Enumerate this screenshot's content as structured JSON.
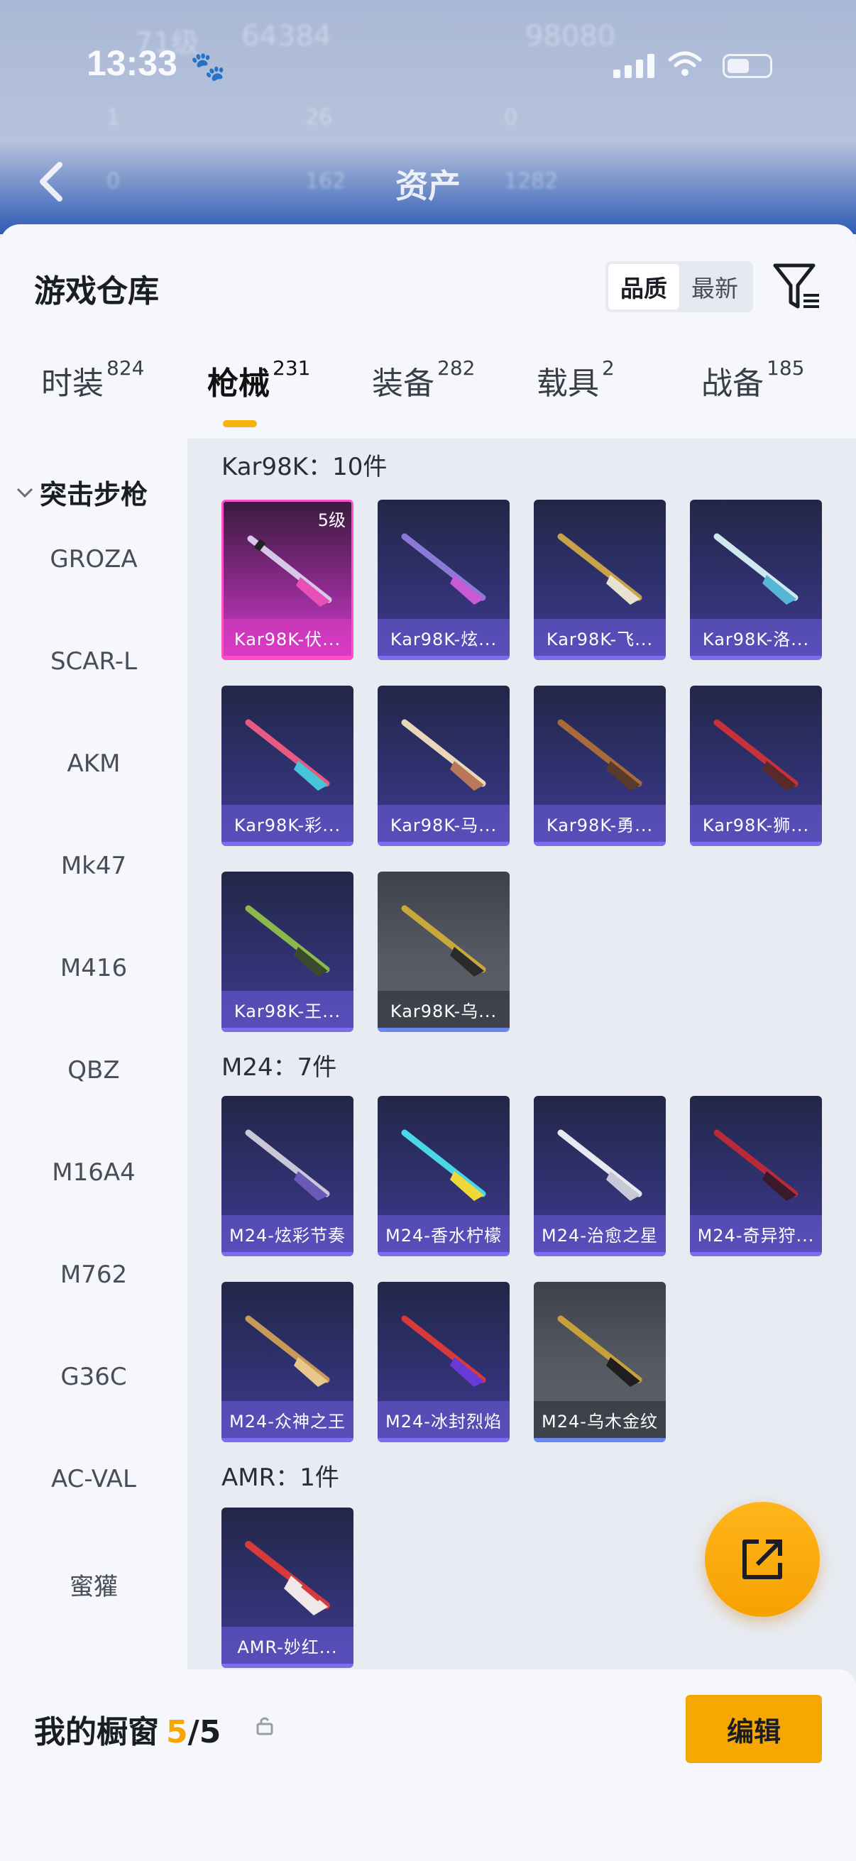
{
  "status_bar": {
    "time": "13:33"
  },
  "background": {
    "level_text": "71级",
    "stat_a": "64384",
    "stat_b": "98080",
    "row1": [
      "1",
      "26",
      "0"
    ],
    "row2": [
      "0",
      "162",
      "1282"
    ],
    "nav_title": "资产"
  },
  "sheet": {
    "title": "游戏仓库",
    "sort_options": [
      {
        "label": "品质",
        "active": true
      },
      {
        "label": "最新",
        "active": false
      }
    ]
  },
  "tabs": [
    {
      "label": "时装",
      "count": "824"
    },
    {
      "label": "枪械",
      "count": "231"
    },
    {
      "label": "装备",
      "count": "282"
    },
    {
      "label": "载具",
      "count": "2"
    },
    {
      "label": "战备",
      "count": "185"
    }
  ],
  "active_tab": "枪械",
  "sidebar": {
    "category": "突击步枪",
    "items": [
      "GROZA",
      "SCAR-L",
      "AKM",
      "Mk47",
      "M416",
      "QBZ",
      "M16A4",
      "M762",
      "G36C",
      "AC-VAL",
      "蜜獾"
    ]
  },
  "groups": [
    {
      "title": "Kar98K：10件",
      "items": [
        {
          "label": "Kar98K-伏...",
          "rarity": "pink",
          "badge": "5级"
        },
        {
          "label": "Kar98K-炫...",
          "rarity": "purple"
        },
        {
          "label": "Kar98K-飞...",
          "rarity": "purple"
        },
        {
          "label": "Kar98K-洛...",
          "rarity": "purple"
        },
        {
          "label": "Kar98K-彩...",
          "rarity": "purple"
        },
        {
          "label": "Kar98K-马...",
          "rarity": "purple"
        },
        {
          "label": "Kar98K-勇...",
          "rarity": "purple"
        },
        {
          "label": "Kar98K-狮...",
          "rarity": "purple"
        },
        {
          "label": "Kar98K-王...",
          "rarity": "purple"
        },
        {
          "label": "Kar98K-乌...",
          "rarity": "grey"
        }
      ]
    },
    {
      "title": "M24：7件",
      "items": [
        {
          "label": "M24-炫彩节奏",
          "rarity": "purple"
        },
        {
          "label": "M24-香水柠檬",
          "rarity": "purple"
        },
        {
          "label": "M24-治愈之星",
          "rarity": "purple"
        },
        {
          "label": "M24-奇异狩...",
          "rarity": "purple"
        },
        {
          "label": "M24-众神之王",
          "rarity": "purple"
        },
        {
          "label": "M24-冰封烈焰",
          "rarity": "purple"
        },
        {
          "label": "M24-乌木金纹",
          "rarity": "grey"
        }
      ]
    },
    {
      "title": "AMR：1件",
      "items": [
        {
          "label": "AMR-妙红...",
          "rarity": "purple"
        }
      ]
    }
  ],
  "bottom": {
    "title": "我的橱窗",
    "current": "5",
    "separator": "/",
    "total": "5",
    "edit_label": "编辑"
  },
  "colors": {
    "accent": "#f7a800",
    "pink_rarity": "#ff4fc7",
    "purple_rarity": "#7d6cf0",
    "grey_rarity": "#6a86f0"
  }
}
